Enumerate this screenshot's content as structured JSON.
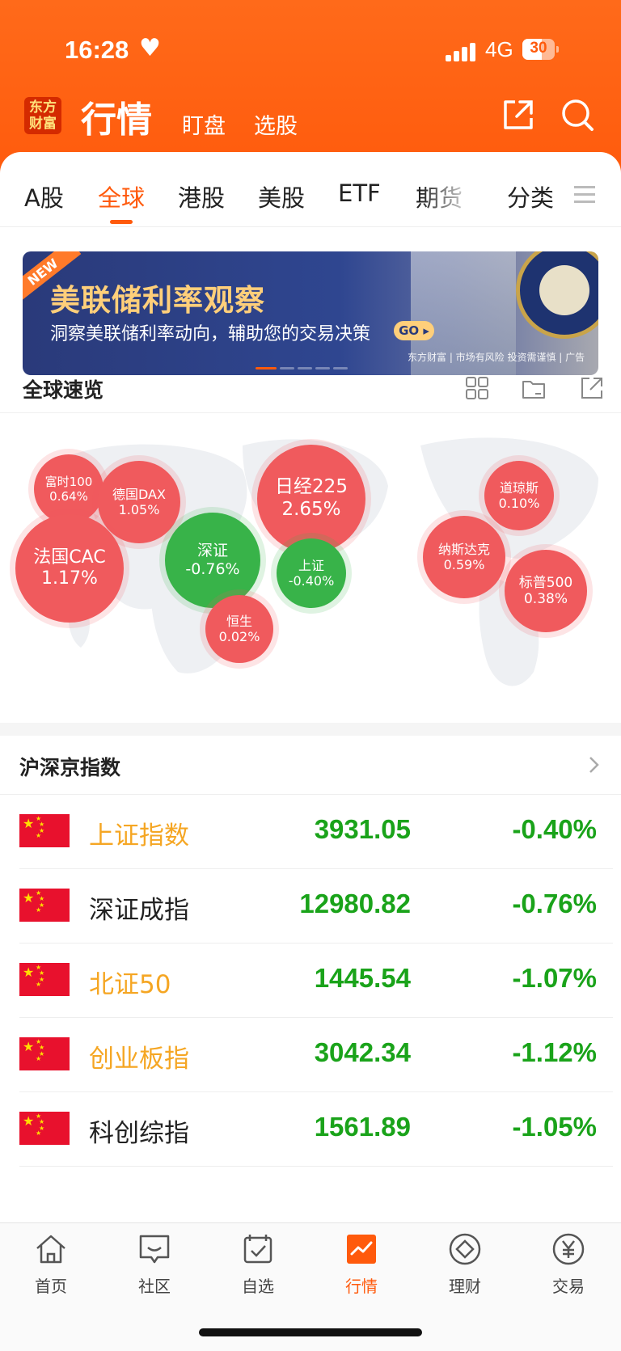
{
  "status_bar": {
    "time": "16:28",
    "network": "4G",
    "battery": "30"
  },
  "app": {
    "logo_text_1": "东方",
    "logo_text_2": "财富",
    "title": "行情",
    "sub1": "盯盘",
    "sub2": "选股"
  },
  "tabs": [
    "A股",
    "全球",
    "港股",
    "美股",
    "ETF",
    "期货",
    "分类"
  ],
  "banner": {
    "new_tag": "NEW",
    "title": "美联储利率观察",
    "subtitle": "洞察美联储利率动向，辅助您的交易决策",
    "go": "GO",
    "footer": "东方财富 | 市场有风险 投资需谨慎 | 广告"
  },
  "overview": {
    "title": "全球速览"
  },
  "bubbles": [
    {
      "name": "富时100",
      "value": "0.64%",
      "dir": "up"
    },
    {
      "name": "德国DAX",
      "value": "1.05%",
      "dir": "up"
    },
    {
      "name": "法国CAC",
      "value": "1.17%",
      "dir": "up"
    },
    {
      "name": "深证",
      "value": "-0.76%",
      "dir": "down"
    },
    {
      "name": "日经225",
      "value": "2.65%",
      "dir": "up"
    },
    {
      "name": "上证",
      "value": "-0.40%",
      "dir": "down"
    },
    {
      "name": "恒生",
      "value": "0.02%",
      "dir": "up"
    },
    {
      "name": "道琼斯",
      "value": "0.10%",
      "dir": "up"
    },
    {
      "name": "纳斯达克",
      "value": "0.59%",
      "dir": "up"
    },
    {
      "name": "标普500",
      "value": "0.38%",
      "dir": "up"
    }
  ],
  "index_section": {
    "title": "沪深京指数"
  },
  "indices": [
    {
      "name": "上证指数",
      "price": "3931.05",
      "change": "-0.40%",
      "name_color": "#f5a623"
    },
    {
      "name": "深证成指",
      "price": "12980.82",
      "change": "-0.76%",
      "name_color": "#222222"
    },
    {
      "name": "北证50",
      "price": "1445.54",
      "change": "-1.07%",
      "name_color": "#f5a623"
    },
    {
      "name": "创业板指",
      "price": "3042.34",
      "change": "-1.12%",
      "name_color": "#f5a623"
    },
    {
      "name": "科创综指",
      "price": "1561.89",
      "change": "-1.05%",
      "name_color": "#222222"
    }
  ],
  "bottom_nav": [
    "首页",
    "社区",
    "自选",
    "行情",
    "理财",
    "交易"
  ],
  "colors": {
    "accent": "#ff5a0c",
    "up": "#f05a5d",
    "down": "#38b349",
    "green_text": "#1aa31a"
  }
}
